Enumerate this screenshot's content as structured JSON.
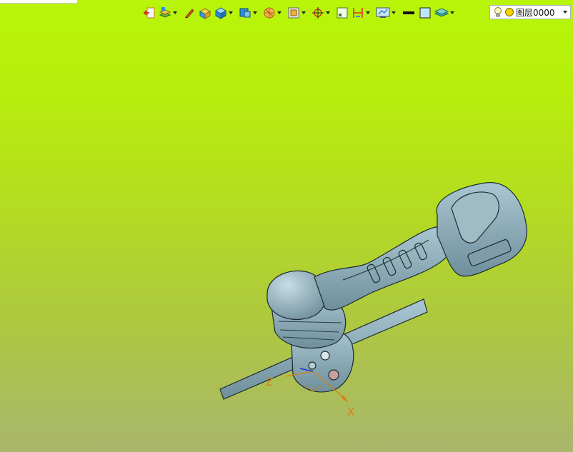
{
  "toolbar": {
    "icons": [
      "exit-sketch-icon",
      "layer-settings-icon",
      "edit-object-display-icon",
      "shade-face-icon",
      "render-style-icon",
      "view-orientation-icon",
      "section-view-icon",
      "wireframe-box-icon",
      "snap-point-icon",
      "grid-icon",
      "dimension-icon",
      "display-control-icon",
      "line-color-icon",
      "face-color-icon",
      "layer-icon"
    ]
  },
  "layer_combo": {
    "label": "图层0000"
  },
  "viewport": {
    "background_top": "#b8f50a",
    "background_bottom": "#a9b66c",
    "model_color": "#8fb0bd",
    "triad": {
      "x_label": "X",
      "z_label": "Z",
      "color": "#d9800e"
    }
  }
}
